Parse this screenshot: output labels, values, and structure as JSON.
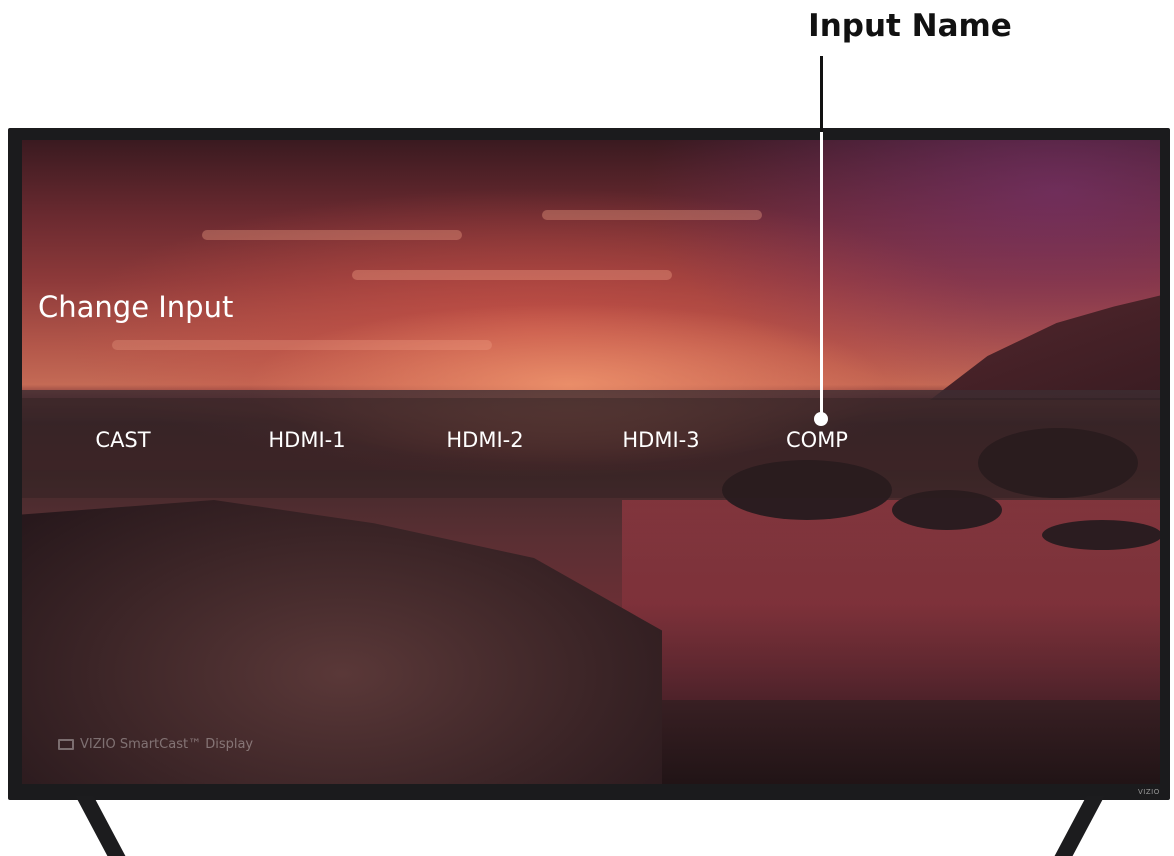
{
  "callout": {
    "label": "Input Name"
  },
  "tv": {
    "menu_title": "Change Input",
    "inputs": [
      {
        "label": "CAST"
      },
      {
        "label": "HDMI-1"
      },
      {
        "label": "HDMI-2"
      },
      {
        "label": "HDMI-3"
      },
      {
        "label": "COMP"
      }
    ],
    "watermark": "VIZIO SmartCast™ Display",
    "brand_logo": "VIZIO"
  },
  "colors": {
    "callout_text": "#111111",
    "tv_frame": "#1b1b1d",
    "menu_text": "#ffffff"
  }
}
